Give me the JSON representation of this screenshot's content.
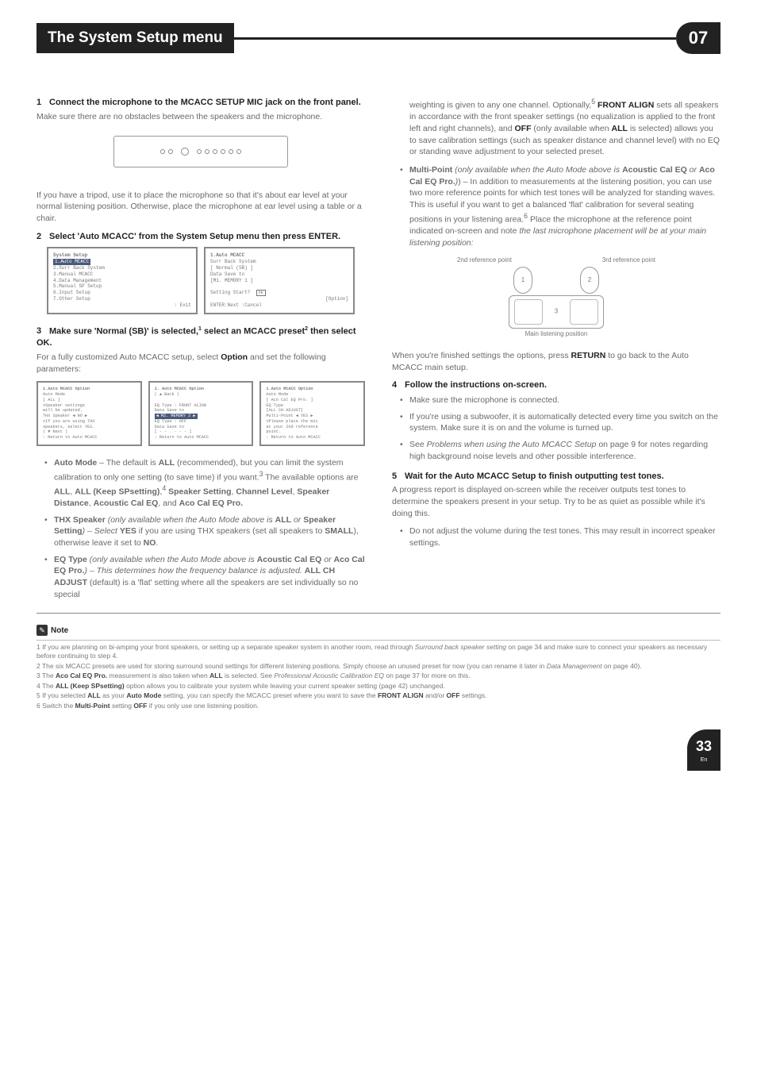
{
  "header": {
    "title": "The System Setup menu",
    "chapter": "07"
  },
  "left": {
    "step1": {
      "num": "1",
      "title": "Connect the microphone to the MCACC SETUP MIC jack on the front panel.",
      "p1": "Make sure there are no obstacles between the speakers and the microphone.",
      "p2": "If you have a tripod, use it to place the microphone so that it's about ear level at your normal listening position. Otherwise, place the microphone at ear level using a table or a chair."
    },
    "step2": {
      "num": "2",
      "title": "Select 'Auto MCACC' from the System Setup menu then press ENTER.",
      "menuA_title": "System Setup",
      "menuA_items": [
        "1.Auto MCACC",
        "2.Surr Back System",
        "3.Manual MCACC",
        "4.Data Management",
        "5.Manual SP Setup",
        "6.Input Setup",
        "7.Other Setup"
      ],
      "menuA_exit": ": Exit",
      "menuB_title": "1.Auto MCACC",
      "menuB_l1": "Surr Back System",
      "menuB_l2": "[    Normal (SB)   ]",
      "menuB_l3": "Data Save to",
      "menuB_l4": "[M1. MEMORY 1 ]",
      "menuB_l5": "Setting Start?",
      "menuB_ok": "OK",
      "menuB_opt": "[Option]",
      "menuB_foot": "ENTER:Next      :Cancel"
    },
    "step3": {
      "num": "3",
      "title_a": "Make sure 'Normal (SB)' is selected,",
      "sup1": "1",
      "title_b": " select an MCACC preset",
      "sup2": "2",
      "title_c": " then select OK.",
      "p1a": "For a fully customized Auto MCACC setup, select ",
      "p1b": "Option",
      "p1c": " and set the following parameters:",
      "m1_title": "1.Auto MCACC Option",
      "m1_l1": "Auto Mode",
      "m1_l2": "[        ALL        ]",
      "m1_l3": "▽Speaker settings",
      "m1_l4": "  will be updated.",
      "m1_l5": "THX Speaker   ◀ NO ▶",
      "m1_l6": "▽If you are using THX",
      "m1_l7": "  speakers, select YES.",
      "m1_l8": "( ▼ Next )",
      "m1_foot": ": Return to Auto MCACC",
      "m2_title": "1. Auto MCACC Option",
      "m2_l1": "( ▲ Back )",
      "m2_l2": "EQ Type : FRONT ALIGN",
      "m2_l3": "Data Save to",
      "m2_l4": "◀ M2. MEMORY 2 ▶",
      "m2_l5": "EQ Type : OFF",
      "m2_l6": "Data Save to",
      "m2_l7": "[ - - . - - -        ]",
      "m2_foot": ": Return to Auto MCACC",
      "m3_title": "1.Auto MCACC Option",
      "m3_l1": "Auto Mode",
      "m3_l2": "[  Aco Cal EQ Pro. ]",
      "m3_l3": "EQ Type",
      "m3_l4": "[ALL CH ADJUST]",
      "m3_l5": "Multi-Point   ◀ YES ▶",
      "m3_l6": "▽Please place the mic",
      "m3_l7": "  at your 2nd reference",
      "m3_l8": "  point.",
      "m3_foot": ": Return to Auto MCACC",
      "b_auto_a": "Auto Mode",
      "b_auto_b": " – The default is ",
      "b_auto_c": "ALL",
      "b_auto_d": " (recommended), but you can limit the system calibration to only one setting (to save time) if you want.",
      "b_auto_sup3": "3",
      "b_auto_e": " The available options are ",
      "b_auto_f": "ALL",
      "b_auto_g": ", ",
      "b_auto_h": "ALL (Keep SPsetting)",
      "b_auto_i": ",",
      "b_auto_sup4": "4",
      "b_auto_j": " ",
      "b_auto_k": "Speaker Setting",
      "b_auto_l": ", ",
      "b_auto_m": "Channel Level",
      "b_auto_n": ", ",
      "b_auto_o": "Speaker Distance",
      "b_auto_p": ", ",
      "b_auto_q": "Acoustic Cal EQ",
      "b_auto_r": ", and ",
      "b_auto_s": "Aco Cal EQ Pro.",
      "b_thx_a": "THX Speaker",
      "b_thx_b": " (only available when the Auto Mode above is ",
      "b_thx_c": "ALL",
      "b_thx_d": " or ",
      "b_thx_e": "Speaker Setting",
      "b_thx_f": ") – Select ",
      "b_thx_g": "YES",
      "b_thx_h": " if you are using THX speakers (set all speakers to ",
      "b_thx_i": "SMALL",
      "b_thx_j": "), otherwise leave it set to ",
      "b_thx_k": "NO",
      "b_thx_l": ".",
      "b_eq_a": "EQ Type",
      "b_eq_b": " (only available when the Auto Mode above is ",
      "b_eq_c": "Acoustic Cal EQ",
      "b_eq_d": " or ",
      "b_eq_e": "Aco Cal EQ Pro.",
      "b_eq_f": ") – This determines how the frequency balance is adjusted. ",
      "b_eq_g": "ALL CH ADJUST",
      "b_eq_h": " (default) is a 'flat' setting where all the speakers are set individually so no special "
    }
  },
  "right": {
    "cont_a": "weighting is given to any one channel. Optionally,",
    "cont_sup5": "5",
    "cont_b": " ",
    "cont_c": "FRONT ALIGN",
    "cont_d": " sets all speakers in accordance with the front speaker settings (no equalization is applied to the front left and right channels), and ",
    "cont_e": "OFF",
    "cont_f": " (only available when ",
    "cont_g": "ALL",
    "cont_h": " is selected) allows you to save calibration settings (such as speaker distance and channel level) with no EQ or standing wave adjustment to your selected preset.",
    "mp_a": "Multi-Point",
    "mp_b": " (only available when the Auto Mode above is ",
    "mp_c": "Acoustic Cal EQ",
    "mp_d": " or ",
    "mp_e": "Aco Cal EQ Pro.",
    "mp_f": ") – In addition to measurements at the listening position, you can use two more reference points for which test tones will be analyzed for standing waves. This is useful if you want to get a balanced 'flat' calibration for several seating positions in your listening area.",
    "mp_sup6": "6",
    "mp_g": " Place the microphone at the reference point indicated on-screen and note ",
    "mp_h": "the last microphone placement will be at your main listening position:",
    "ref2": "2nd reference point",
    "ref3": "3rd reference point",
    "mainpos": "Main listening position",
    "pt1": "1",
    "pt2": "2",
    "pt3": "3",
    "afteropts_a": "When you're finished settings the options, press ",
    "afteropts_b": "RETURN",
    "afteropts_c": " to go back to the Auto MCACC main setup.",
    "step4": {
      "num": "4",
      "title": "Follow the instructions on-screen."
    },
    "s4_b1": "Make sure the microphone is connected.",
    "s4_b2": "If you're using a subwoofer, it is automatically detected every time you switch on the system. Make sure it is on and the volume is turned up.",
    "s4_b3a": "See ",
    "s4_b3b": "Problems when using the Auto MCACC Setup",
    "s4_b3c": " on page 9 for notes regarding high background noise levels and other possible interference.",
    "step5": {
      "num": "5",
      "title": "Wait for the Auto MCACC Setup to finish outputting test tones."
    },
    "s5_p": "A progress report is displayed on-screen while the receiver outputs test tones to determine the speakers present in your setup. Try to be as quiet as possible while it's doing this.",
    "s5_b1": "Do not adjust the volume during the test tones. This may result in incorrect speaker settings."
  },
  "note": {
    "icon": "✎",
    "label": "Note"
  },
  "footnotes": {
    "f1a": "1 If you are planning on bi-amping your front speakers, or setting up a separate speaker system in another room, read through ",
    "f1b": "Surround back speaker setting",
    "f1c": " on page 34 and make sure to connect your speakers as necessary before continuing to step 4.",
    "f2a": "2 The six MCACC presets are used for storing surround sound settings for different listening positions. Simply choose an unused preset for now (you can rename it later in ",
    "f2b": "Data Management",
    "f2c": " on page 40).",
    "f3a": "3 The ",
    "f3b": "Aco Cal EQ Pro.",
    "f3c": " measurement is also taken when ",
    "f3d": "ALL",
    "f3e": " is selected. See ",
    "f3f": "Professional Acoustic Calibration EQ",
    "f3g": " on page 37 for more on this.",
    "f4a": "4 The ",
    "f4b": "ALL (Keep SPsetting)",
    "f4c": " option allows you to calibrate your system while leaving your current speaker setting (page 42) unchanged.",
    "f5a": "5 If you selected ",
    "f5b": "ALL",
    "f5c": " as your ",
    "f5d": "Auto Mode",
    "f5e": " setting, you can specify the MCACC preset where you want to save the ",
    "f5f": "FRONT ALIGN",
    "f5g": " and/or ",
    "f5h": "OFF",
    "f5i": " settings.",
    "f6a": "6 Switch the ",
    "f6b": "Multi-Point",
    "f6c": " setting ",
    "f6d": "OFF",
    "f6e": " if you only use one listening position."
  },
  "pagefoot": {
    "num": "33",
    "lang": "En"
  }
}
